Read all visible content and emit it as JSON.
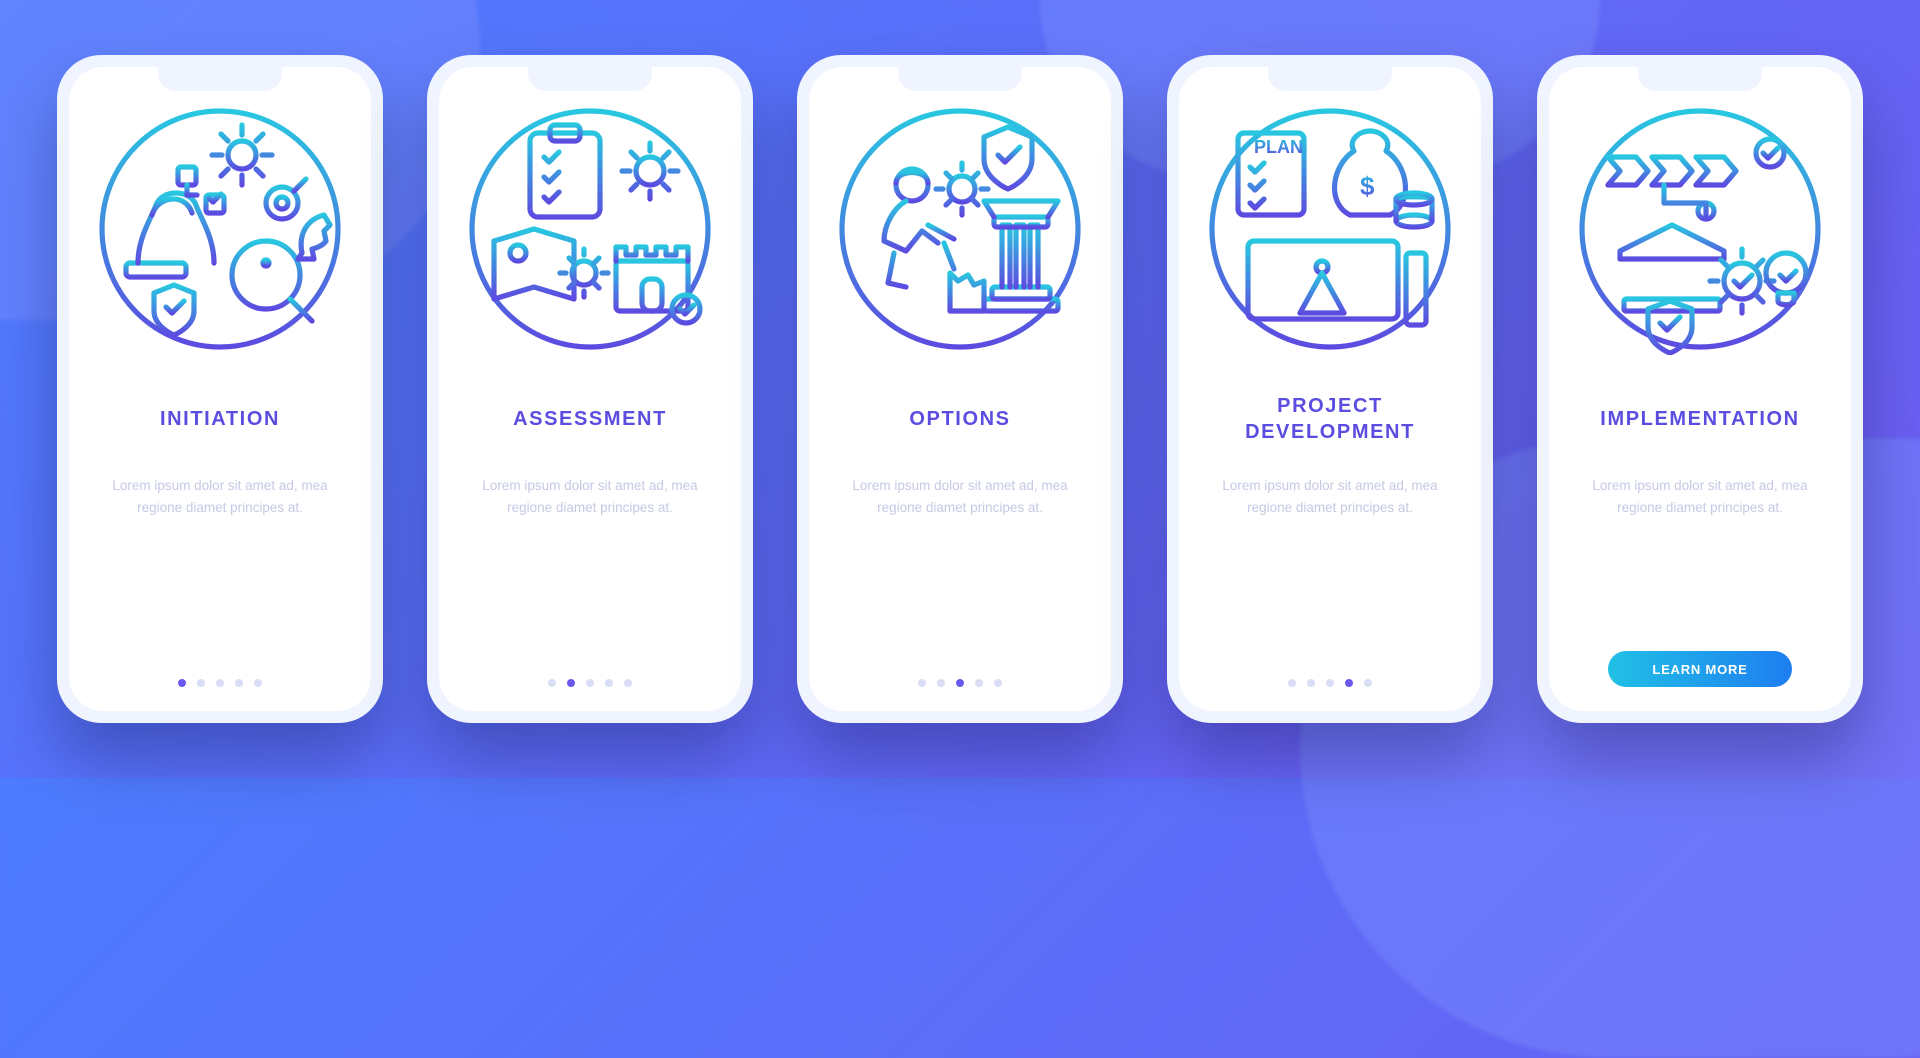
{
  "cta_label": "LEARN MORE",
  "body_text": "Lorem ipsum dolor sit amet ad, mea regione diamet principes at.",
  "cards": [
    {
      "title": "INITIATION",
      "active_dot": 0,
      "has_cta": false,
      "icon": "initiation-icon"
    },
    {
      "title": "ASSESSMENT",
      "active_dot": 1,
      "has_cta": false,
      "icon": "assessment-icon"
    },
    {
      "title": "OPTIONS",
      "active_dot": 2,
      "has_cta": false,
      "icon": "options-icon"
    },
    {
      "title": "PROJECT DEVELOPMENT",
      "active_dot": 3,
      "has_cta": false,
      "icon": "project-dev-icon"
    },
    {
      "title": "IMPLEMENTATION",
      "active_dot": 4,
      "has_cta": true,
      "icon": "implementation-icon"
    }
  ],
  "colors": {
    "grad_top": "#28c7e0",
    "grad_bot": "#5c4be0"
  }
}
